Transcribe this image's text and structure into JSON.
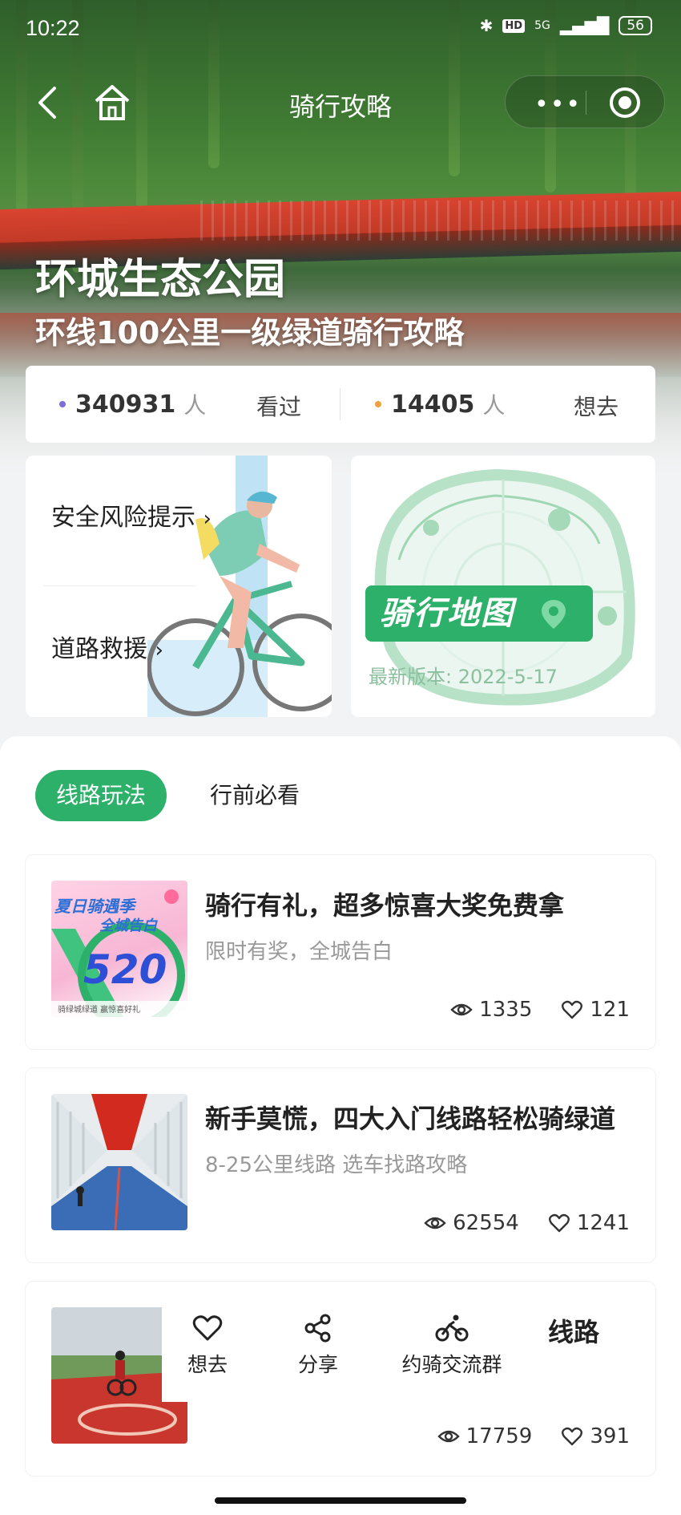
{
  "status_bar": {
    "time": "10:22",
    "network": "5G",
    "hd": "HD",
    "battery": "56"
  },
  "nav": {
    "title": "骑行攻略"
  },
  "hero": {
    "title": "环城生态公园",
    "subtitle": "环线100公里一级绿道骑行攻略"
  },
  "stats": {
    "viewed": {
      "count": "340931",
      "unit": "人",
      "label": "看过",
      "dot_color": "#7b6fd6"
    },
    "want": {
      "count": "14405",
      "unit": "人",
      "label": "想去",
      "dot_color": "#f0a03c"
    }
  },
  "safety_card": {
    "risk_label": "安全风险提示",
    "rescue_label": "道路救援"
  },
  "map_card": {
    "badge": "骑行地图",
    "version": "最新版本: 2022-5-17"
  },
  "tabs": [
    {
      "label": "线路玩法",
      "active": true
    },
    {
      "label": "行前必看",
      "active": false
    }
  ],
  "articles": [
    {
      "title": "骑行有礼，超多惊喜大奖免费拿",
      "subtitle": "限时有奖，全城告白",
      "views": "1335",
      "likes": "121",
      "thumb": {
        "line1": "夏日骑遇季",
        "line2": "全城告白",
        "number": "520",
        "footer": "骑绿城绿道 赢惊喜好礼"
      }
    },
    {
      "title": "新手莫慌，四大入门线路轻松骑绿道",
      "subtitle": "8-25公里线路 选车找路攻略",
      "views": "62554",
      "likes": "1241"
    },
    {
      "title": "线路",
      "subtitle": "",
      "views": "17759",
      "likes": "391"
    }
  ],
  "actions": {
    "want": "想去",
    "share": "分享",
    "group": "约骑交流群"
  },
  "colors": {
    "accent": "#2db069",
    "bridge": "#d94430"
  }
}
